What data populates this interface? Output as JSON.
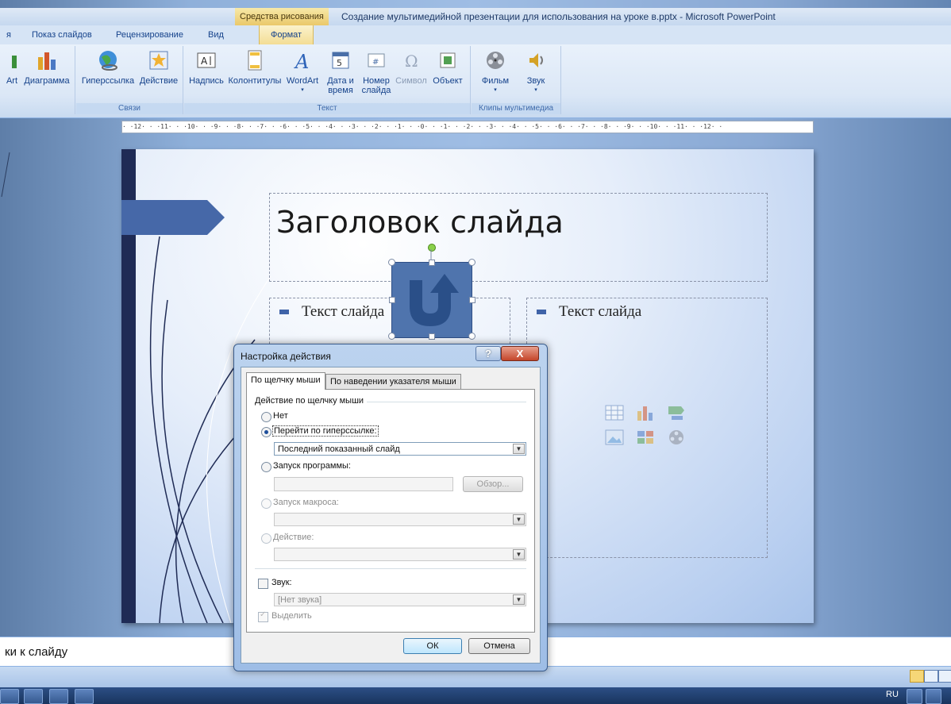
{
  "window": {
    "context_tab": "Средства рисования",
    "title": "Создание мультимедийной презентации для использования на уроке в.pptx - Microsoft PowerPoint"
  },
  "ribbon_tabs": [
    "я",
    "Показ слайдов",
    "Рецензирование",
    "Вид",
    "Формат"
  ],
  "ribbon": {
    "btn_wordart_partial": "Art",
    "btn_chart": "Диаграмма",
    "btn_hyperlink": "Гиперссылка",
    "btn_action": "Действие",
    "group_links": "Связи",
    "btn_textbox": "Надпись",
    "btn_headerfooter": "Колонтитулы",
    "btn_wordart": "WordArt",
    "btn_datetime_1": "Дата и",
    "btn_datetime_2": "время",
    "btn_slidenum_1": "Номер",
    "btn_slidenum_2": "слайда",
    "btn_symbol": "Символ",
    "btn_object": "Объект",
    "group_text": "Текст",
    "btn_movie": "Фильм",
    "btn_sound": "Звук",
    "group_media": "Клипы мультимедиа"
  },
  "ruler_text": "· ·12· · ·11· · ·10· · ·9· · ·8· · ·7· · ·6· · ·5· · ·4· · ·3· · ·2· · ·1· · ·0· · ·1· · ·2· · ·3· · ·4· · ·5· · ·6· · ·7· · ·8· · ·9· · ·10· · ·11· · ·12· ·",
  "slide": {
    "title": "Заголовок слайда",
    "left_text": "Текст слайда",
    "right_text": "Текст слайда"
  },
  "notes_text": "ки к слайду",
  "dialog": {
    "title": "Настройка действия",
    "help": "?",
    "close": "X",
    "tab_click": "По щелчку мыши",
    "tab_hover": "По наведении указателя мыши",
    "group_label": "Действие по щелчку мыши",
    "opt_none": "Нет",
    "opt_hyperlink": "Перейти по гиперссылке:",
    "hyperlink_value": "Последний показанный слайд",
    "opt_program": "Запуск программы:",
    "browse": "Обзор...",
    "opt_macro": "Запуск макроса:",
    "opt_action": "Действие:",
    "sound_label": "Звук:",
    "sound_value": "[Нет звука]",
    "highlight_label": "Выделить",
    "ok": "ОК",
    "cancel": "Отмена"
  },
  "taskbar": {
    "lang": "RU"
  },
  "colors": {
    "accent": "#4f74ad",
    "slide_bar": "#1f2b55",
    "ribbon_bg": "#dbe7f6",
    "context_tab": "#eac86a"
  }
}
